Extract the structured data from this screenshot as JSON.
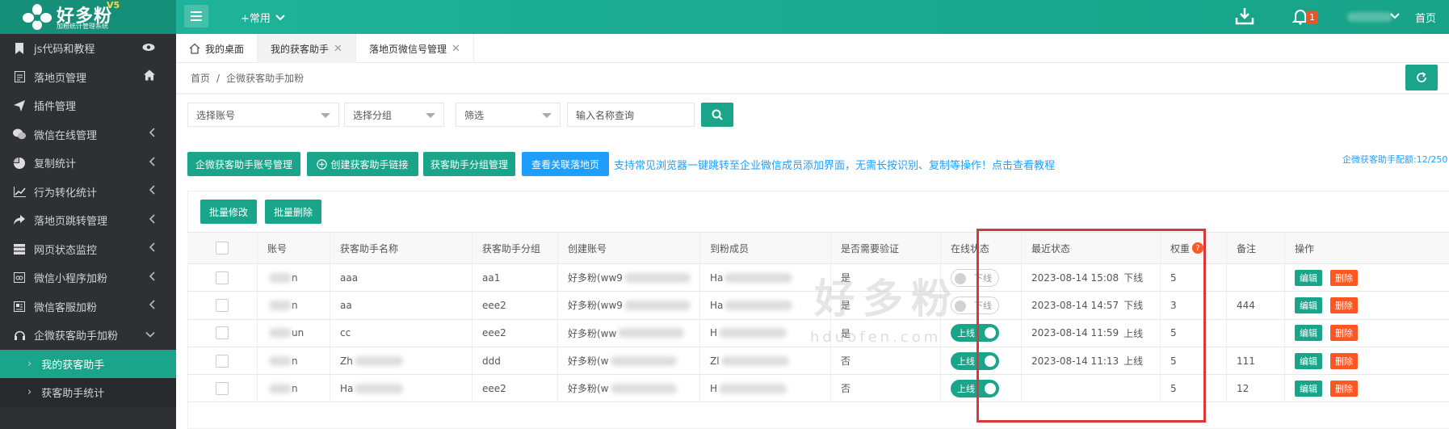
{
  "brand": {
    "title": "好多粉",
    "badge": "V5",
    "subtitle": "加粉统计管理系统"
  },
  "topbar": {
    "common_menu": "+常用",
    "notice_count": "1",
    "home": "首页"
  },
  "sidebar": {
    "items": [
      {
        "label": "js代码和教程",
        "icon": "bookmark-icon",
        "right": "eye-icon"
      },
      {
        "label": "落地页管理",
        "icon": "page-icon",
        "right": "home-icon"
      },
      {
        "label": "插件管理",
        "icon": "paper-plane-icon",
        "right": ""
      },
      {
        "label": "微信在线管理",
        "icon": "wechat-icon",
        "right": "chevron-left-icon"
      },
      {
        "label": "复制统计",
        "icon": "pie-chart-icon",
        "right": "chevron-left-icon"
      },
      {
        "label": "行为转化统计",
        "icon": "line-chart-icon",
        "right": "chevron-left-icon"
      },
      {
        "label": "落地页跳转管理",
        "icon": "share-icon",
        "right": "chevron-left-icon"
      },
      {
        "label": "网页状态监控",
        "icon": "server-icon",
        "right": "chevron-left-icon"
      },
      {
        "label": "微信小程序加粉",
        "icon": "mini-program-icon",
        "right": "chevron-left-icon"
      },
      {
        "label": "微信客服加粉",
        "icon": "customer-service-icon",
        "right": "chevron-left-icon"
      },
      {
        "label": "企微获客助手加粉",
        "icon": "headset-icon",
        "right": "chevron-down-icon"
      }
    ],
    "sub_items": [
      {
        "label": "我的获客助手",
        "active": true
      },
      {
        "label": "获客助手统计",
        "active": false
      }
    ]
  },
  "tabs": [
    {
      "label": "我的桌面",
      "closable": false
    },
    {
      "label": "我的获客助手",
      "closable": true,
      "active": true
    },
    {
      "label": "落地页微信号管理",
      "closable": true
    }
  ],
  "breadcrumb": {
    "home": "首页",
    "sep": "/",
    "current": "企微获客助手加粉"
  },
  "filters": {
    "account_placeholder": "选择账号",
    "group_placeholder": "选择分组",
    "filter_placeholder": "筛选",
    "name_placeholder": "输入名称查询"
  },
  "actions": {
    "account_manage": "企微获客助手账号管理",
    "create_link": "创建获客助手链接",
    "group_manage": "获客助手分组管理",
    "view_pages": "查看关联落地页",
    "notice": "支持常见浏览器一键跳转至企业微信成员添加界面，无需长按识别、复制等操作！点击查看教程",
    "quota": "企微获客助手配额:12/250",
    "batch_edit": "批量修改",
    "batch_delete": "批量删除"
  },
  "watermark": {
    "main": "好多粉",
    "sub": "hduofen.com"
  },
  "table": {
    "headers": [
      "账号",
      "获客助手名称",
      "获客助手分组",
      "创建账号",
      "到粉成员",
      "是否需要验证",
      "在线状态",
      "最近状态",
      "权重",
      "备注",
      "操作"
    ],
    "rows": [
      {
        "account": "n",
        "name": "aaa",
        "group": "aa1",
        "creator": "好多粉(ww9",
        "member": "Ha",
        "verify": "是",
        "online": false,
        "online_label": "下线",
        "recent_time": "2023-08-14 15:08",
        "recent_state": "下线",
        "weight": "5",
        "note": ""
      },
      {
        "account": "n",
        "name": "aa",
        "group": "eee2",
        "creator": "好多粉(ww9",
        "member": "Ha",
        "verify": "是",
        "online": false,
        "online_label": "下线",
        "recent_time": "2023-08-14 14:57",
        "recent_state": "下线",
        "weight": "3",
        "note": "444"
      },
      {
        "account": "un",
        "name": "cc",
        "group": "eee2",
        "creator": "好多粉(ww",
        "member": "H",
        "verify": "是",
        "online": true,
        "online_label": "上线",
        "recent_time": "2023-08-14 11:59",
        "recent_state": "上线",
        "weight": "5",
        "note": ""
      },
      {
        "account": "n",
        "name": "Zh",
        "group": "ddd",
        "creator": "好多粉(w",
        "member": "Zl",
        "verify": "否",
        "online": true,
        "online_label": "上线",
        "recent_time": "2023-08-14 11:13",
        "recent_state": "上线",
        "weight": "5",
        "note": "111"
      },
      {
        "account": "n",
        "name": "Ha",
        "group": "eee2",
        "creator": "好多粉(w",
        "member": "H",
        "verify": "否",
        "online": true,
        "online_label": "上线",
        "recent_time": "",
        "recent_state": "",
        "weight": "5",
        "note": "12"
      }
    ],
    "edit_label": "编辑",
    "delete_label": "删除"
  },
  "colors": {
    "primary": "#1aa58a",
    "blue": "#1e9fff",
    "danger": "#ff5722",
    "sidebar": "#2f3034",
    "highlight": "#d9383a"
  }
}
